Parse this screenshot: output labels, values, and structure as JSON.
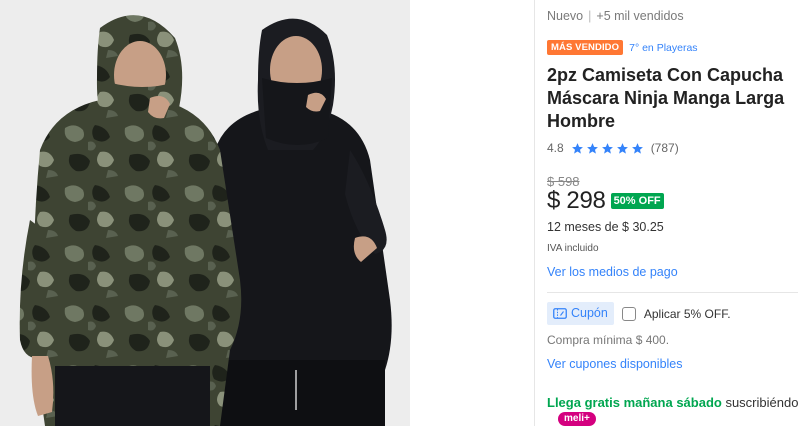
{
  "gallery": {
    "image_alt": "Dos hombres con sudadera y máscara ninja, una camuflaje y una negra",
    "colors": {
      "background": "#ededed",
      "camo_base": "#3e4433",
      "camo_dark": "#1f231b",
      "camo_light": "#6f7863",
      "black_shirt": "#15161a",
      "skin": "#c79f86"
    }
  },
  "product": {
    "condition": "Nuevo",
    "separator": "|",
    "sold": "+5 mil vendidos",
    "badge": "MÁS VENDIDO",
    "rank": "7° en Playeras",
    "title_lines": [
      "2pz Camiseta Con Capucha",
      "Máscara Ninja Manga Larga",
      "Hombre"
    ],
    "rating": "4.8",
    "stars": 5,
    "reviews": "(787)",
    "old_price": "$ 598",
    "price": "$ 298",
    "discount": "50% OFF",
    "installments": "12 meses de $ 30.25",
    "iva": "IVA incluido",
    "payment_link": "Ver los medios de pago",
    "coupon_label": "Cupón",
    "coupon_apply": "Aplicar 5% OFF.",
    "coupon_checked": false,
    "minimum": "Compra mínima $ 400.",
    "coupons_link": "Ver cupones disponibles",
    "shipping_green": "Llega gratis mañana sábado",
    "shipping_rest": " suscribiéndote a",
    "meli_badge": "meli+"
  },
  "colors": {
    "accent": "#3483fa",
    "badge_orange": "#ff7733",
    "discount_green": "#00a650",
    "meli_pink": "#d4007f"
  }
}
